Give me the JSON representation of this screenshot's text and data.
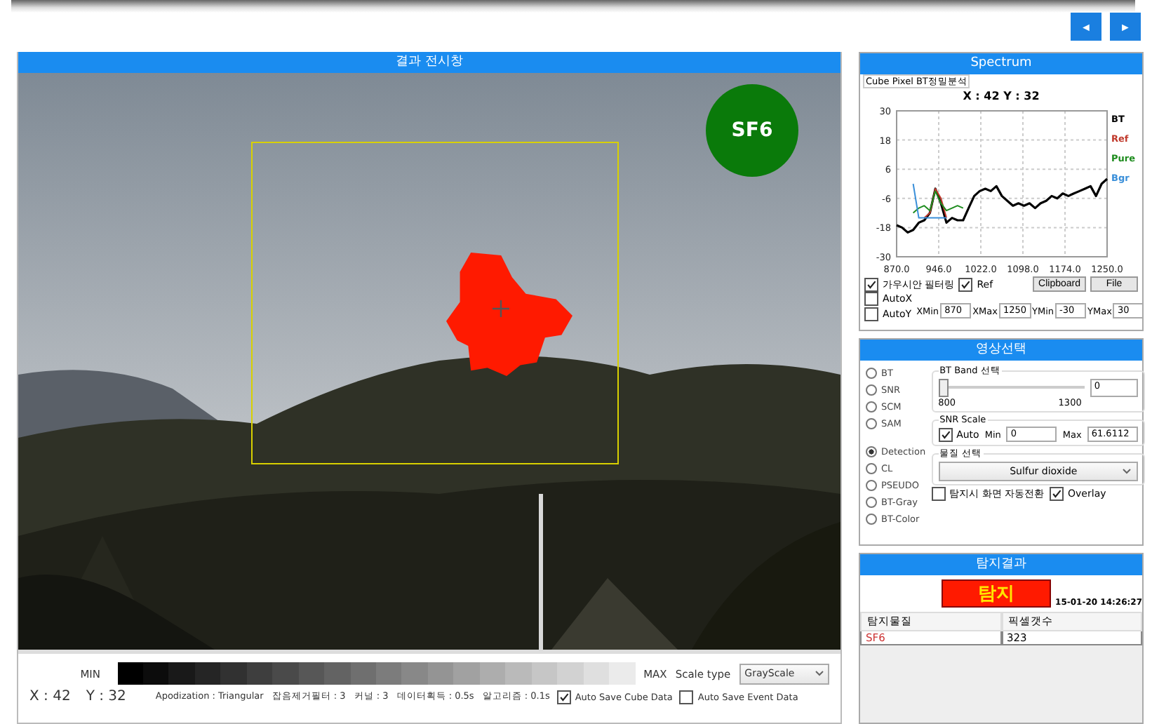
{
  "nav_buttons": [
    {
      "label": "◄"
    },
    {
      "label": "►"
    }
  ],
  "display": {
    "title": "결과 전시창",
    "gas_badge": "SF6"
  },
  "colorbar": {
    "min_label": "MIN",
    "max_label": "MAX",
    "scale_type_label": "Scale type",
    "scale_type": "GrayScale"
  },
  "status": {
    "x": "X : 42",
    "y": "Y : 32",
    "params": [
      "Apodization : Triangular",
      "잡음제거필터 : 3",
      "커널 : 3",
      "데이터획득 : 0.5s",
      "알고리즘 : 0.1s"
    ]
  },
  "auto_save": [
    {
      "label": "Auto Save Cube Data",
      "checked": true
    },
    {
      "label": "Auto Save Event Data",
      "checked": false
    }
  ],
  "spectrum": {
    "title": "Spectrum",
    "tab": "Cube Pixel BT정밀분석",
    "coords": "X : 42 Y : 32",
    "chart_data": {
      "type": "line",
      "x": [
        870,
        880,
        890,
        900,
        910,
        920,
        930,
        940,
        950,
        960,
        970,
        980,
        990,
        1000,
        1010,
        1020,
        1030,
        1040,
        1050,
        1060,
        1070,
        1080,
        1090,
        1100,
        1110,
        1120,
        1130,
        1140,
        1150,
        1160,
        1170,
        1180,
        1190,
        1200,
        1210,
        1220,
        1230,
        1240,
        1250
      ],
      "series": [
        {
          "name": "BT",
          "color": "#000000",
          "values": [
            -17,
            -18,
            -20,
            -19,
            -16,
            -15,
            -12,
            -2,
            -8,
            -16,
            -14,
            -15,
            -15,
            -10,
            -5,
            -3,
            -2,
            -3,
            -1,
            -5,
            -7,
            -9,
            -8,
            -9,
            -8,
            -10,
            -8,
            -7,
            -5,
            -6,
            -4,
            -5,
            -4,
            -3,
            -2,
            -1,
            -5,
            0,
            2
          ]
        },
        {
          "name": "Ref",
          "color": "#c0392b",
          "values": [
            null,
            null,
            null,
            null,
            null,
            -14,
            -12,
            -2,
            -6,
            -14,
            null,
            null,
            null,
            null,
            null,
            null,
            null,
            null,
            null,
            null,
            null,
            null,
            null,
            null,
            null,
            null,
            null,
            null,
            null,
            null,
            null,
            null,
            null,
            null,
            null,
            null,
            null,
            null,
            null
          ]
        },
        {
          "name": "Pure",
          "color": "#1e8c1e",
          "values": [
            null,
            null,
            null,
            -12,
            -10,
            -9,
            -11,
            -3,
            -8,
            -11,
            -10,
            -9,
            -10,
            null,
            null,
            null,
            null,
            null,
            null,
            null,
            null,
            null,
            null,
            null,
            null,
            null,
            null,
            null,
            null,
            null,
            null,
            null,
            null,
            null,
            null,
            null,
            null,
            null,
            null
          ]
        },
        {
          "name": "Bgr",
          "color": "#3a8fd9",
          "values": [
            null,
            null,
            null,
            0,
            -14,
            -14,
            -14,
            -14,
            -14,
            -14,
            null,
            null,
            null,
            null,
            null,
            null,
            null,
            null,
            null,
            null,
            null,
            null,
            null,
            null,
            null,
            null,
            null,
            null,
            null,
            null,
            null,
            null,
            null,
            null,
            null,
            null,
            null,
            null,
            null
          ]
        }
      ],
      "xlim": [
        870,
        1250
      ],
      "ylim": [
        -30,
        30
      ],
      "xticks": [
        {
          "value": 870,
          "label": "870.0"
        },
        {
          "value": 946,
          "label": "946.0"
        },
        {
          "value": 1022,
          "label": "1022.0"
        },
        {
          "value": 1098,
          "label": "1098.0"
        },
        {
          "value": 1174,
          "label": "1174.0"
        },
        {
          "value": 1250,
          "label": "1250.0"
        }
      ],
      "yticks": [
        30,
        18,
        6,
        -6,
        -18,
        -30
      ],
      "grid": true
    },
    "options": [
      {
        "label": "가우시안 필터링",
        "checked": true
      },
      {
        "label": "Ref",
        "checked": true
      },
      {
        "label": "AutoX",
        "checked": false
      },
      {
        "label": "AutoY",
        "checked": false
      }
    ],
    "buttons": [
      "Clipboard",
      "File"
    ],
    "fields": [
      {
        "label": "XMin",
        "value": "870"
      },
      {
        "label": "XMax",
        "value": "1250"
      },
      {
        "label": "YMin",
        "value": "-30"
      },
      {
        "label": "YMax",
        "value": "30"
      }
    ]
  },
  "image_select": {
    "title": "영상선택",
    "modes": [
      {
        "label": "BT",
        "selected": false
      },
      {
        "label": "SNR",
        "selected": false
      },
      {
        "label": "SCM",
        "selected": false
      },
      {
        "label": "SAM",
        "selected": false
      },
      {
        "label": "Detection",
        "selected": true
      },
      {
        "label": "CL",
        "selected": false
      },
      {
        "label": "PSEUDO",
        "selected": false
      },
      {
        "label": "BT-Gray",
        "selected": false
      },
      {
        "label": "BT-Color",
        "selected": false
      }
    ],
    "bt_band": {
      "title": "BT Band 선택",
      "level": 0,
      "value": "0",
      "min": "800",
      "max": "1300"
    },
    "snr_scale": {
      "title": "SNR Scale",
      "auto_label": "Auto",
      "auto_checked": true,
      "min_label": "Min",
      "min": "0",
      "max_label": "Max",
      "max": "61.6112"
    },
    "material": {
      "title": "물질 선택",
      "value": "Sulfur dioxide"
    },
    "auto_switch": {
      "label": "탐지시 화면 자동전환",
      "checked": false
    },
    "overlay": {
      "label": "Overlay",
      "checked": true
    }
  },
  "result": {
    "title": "탐지결과",
    "alarm": "탐지",
    "timestamp": "15-01-20 14:26:27",
    "columns": [
      "탐지물질",
      "픽셀갯수"
    ],
    "rows": [
      [
        "SF6",
        "323"
      ]
    ]
  }
}
